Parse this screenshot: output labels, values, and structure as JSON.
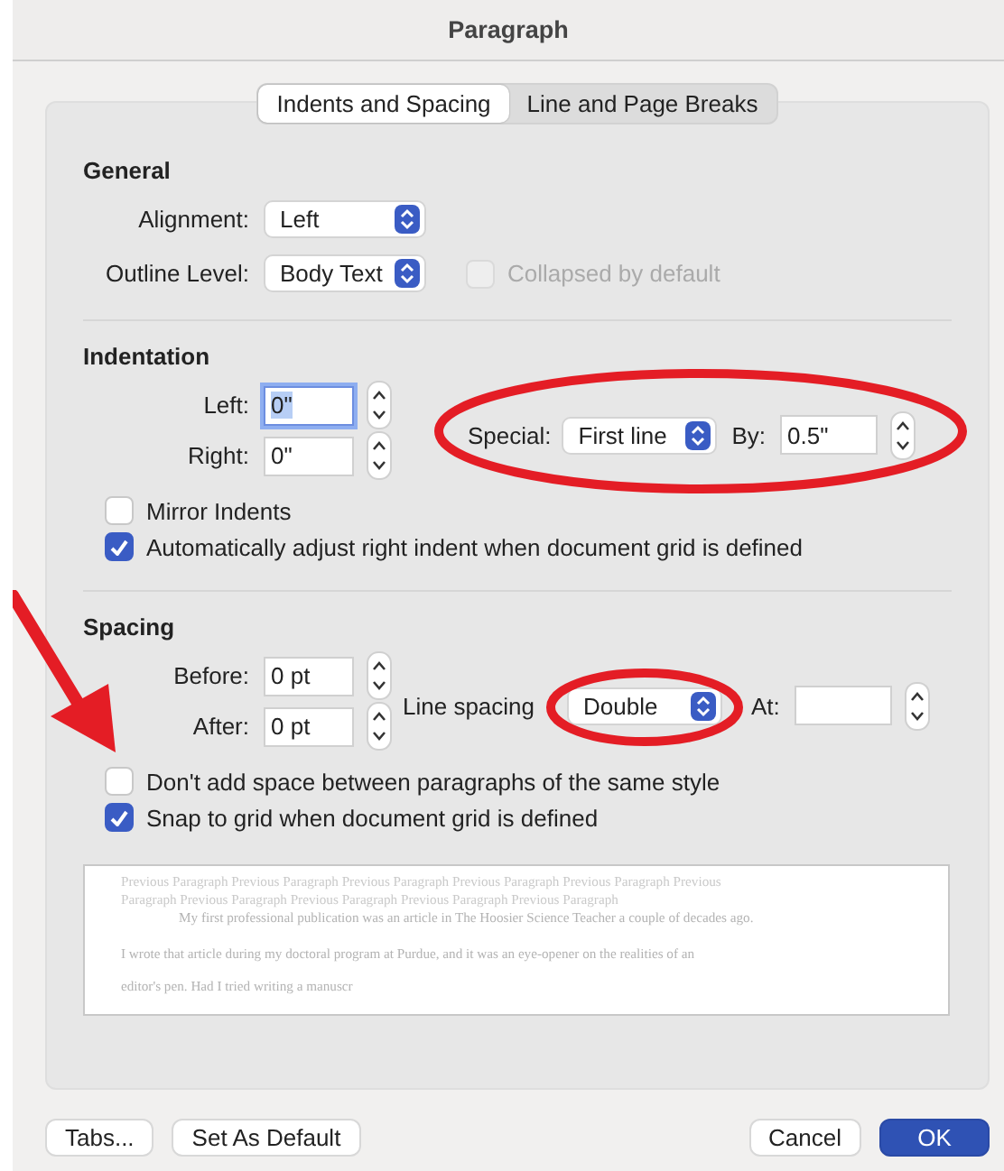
{
  "window": {
    "title": "Paragraph"
  },
  "tabs": [
    {
      "label": "Indents and Spacing",
      "selected": true
    },
    {
      "label": "Line and Page Breaks",
      "selected": false
    }
  ],
  "general": {
    "heading": "General",
    "alignment": {
      "label": "Alignment:",
      "value": "Left"
    },
    "outline_level": {
      "label": "Outline Level:",
      "value": "Body Text"
    },
    "collapsed": {
      "label": "Collapsed by default",
      "checked": false,
      "disabled": true
    }
  },
  "indentation": {
    "heading": "Indentation",
    "left": {
      "label": "Left:",
      "value": "0\"",
      "focused": true
    },
    "right": {
      "label": "Right:",
      "value": "0\"",
      "focused": false
    },
    "special": {
      "label": "Special:",
      "value": "First line",
      "circled": true
    },
    "by": {
      "label": "By:",
      "value": "0.5\""
    },
    "checkboxes": [
      {
        "label": "Mirror Indents",
        "checked": false
      },
      {
        "label": "Automatically adjust right indent when document grid is defined",
        "checked": true
      }
    ]
  },
  "spacing": {
    "heading": "Spacing",
    "before": {
      "label": "Before:",
      "value": "0 pt",
      "focused": false
    },
    "after": {
      "label": "After:",
      "value": "0 pt",
      "focused": false
    },
    "line_spacing": {
      "label": "Line spacing",
      "value": "Double",
      "circled": true
    },
    "at": {
      "label": "At:"
    },
    "checkboxes": [
      {
        "label": "Don't add space between paragraphs of the same style",
        "checked": false,
        "arrow": true
      },
      {
        "label": "Snap to grid when document grid is defined",
        "checked": true
      }
    ]
  },
  "preview": {
    "previous": [
      "Previous Paragraph Previous Paragraph Previous Paragraph Previous Paragraph Previous Paragraph Previous",
      "Paragraph Previous Paragraph Previous Paragraph Previous Paragraph Previous Paragraph"
    ],
    "sample": [
      "My first professional publication was an article in The Hoosier Science Teacher a couple of decades ago.",
      "I wrote that article during my doctoral program at Purdue, and it was an eye-opener on the realities of an",
      "editor's pen. Had I tried writing a manuscr"
    ]
  },
  "buttons_left": [
    {
      "label": "Tabs...",
      "kind": "plain"
    },
    {
      "label": "Set As Default",
      "kind": "plain"
    }
  ],
  "buttons_right": [
    {
      "label": "Cancel",
      "kind": "plain"
    },
    {
      "label": "OK",
      "kind": "default"
    }
  ]
}
